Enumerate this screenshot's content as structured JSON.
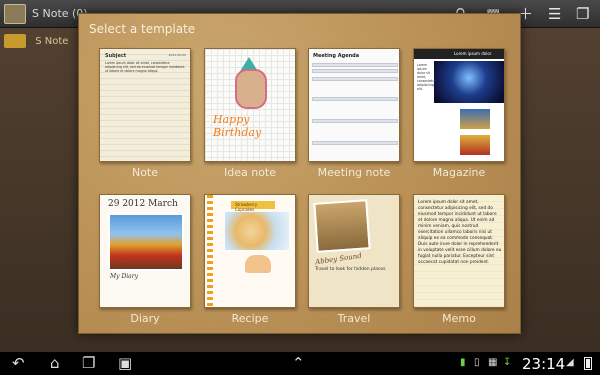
{
  "app": {
    "title": "S Note (0)",
    "folder_label": "S Note",
    "actions": [
      "search-icon",
      "trash-icon",
      "add-icon",
      "menu-icon",
      "window-icon"
    ]
  },
  "dialog": {
    "title": "Select a template",
    "templates": [
      {
        "label": "Note",
        "preview": {
          "heading": "Subject",
          "date": "2012-00-00",
          "body": "Lorem ipsum dolor sit amet, consectetur adipisicing elit, sed do eiusmod tempor incididunt ut labore et dolore magna aliqua."
        }
      },
      {
        "label": "Idea note",
        "preview": {
          "text": "Happy Birthday"
        }
      },
      {
        "label": "Meeting note",
        "preview": {
          "heading": "Meeting Agenda"
        }
      },
      {
        "label": "Magazine",
        "preview": {
          "heading": "Lorem ipsum dolor",
          "lead": "Lorem ipsum dolor sit amet, consectetur adipisicing elit."
        }
      },
      {
        "label": "Diary",
        "preview": {
          "date": "29 2012 March",
          "caption": "My Diary"
        }
      },
      {
        "label": "Recipe",
        "preview": {
          "banner": "Strawberry Cupcakes"
        }
      },
      {
        "label": "Travel",
        "preview": {
          "script": "Abbey Sound",
          "heading": "Travel to look for hidden places"
        }
      },
      {
        "label": "Memo",
        "preview": {
          "body": "Lorem ipsum dolor sit amet, consectetur adipisicing elit, sed do eiusmod tempor incididunt ut labore et dolore magna aliqua. Ut enim ad minim veniam, quis nostrud exercitation ullamco laboris nisi ut aliquip ex ea commodo consequat. Duis aute irure dolor in reprehenderit in voluptate velit esse cillum dolore eu fugiat nulla pariatur. Excepteur sint occaecat cupidatat non proident."
        }
      }
    ]
  },
  "system_bar": {
    "time": "23:14",
    "nav_icons": [
      "back-icon",
      "home-icon",
      "recent-apps-icon",
      "screenshot-icon"
    ],
    "status_icons": [
      "up-arrow-icon",
      "notification-icon",
      "sd-card-icon",
      "image-icon",
      "download-icon",
      "wifi-icon",
      "battery-icon"
    ]
  }
}
